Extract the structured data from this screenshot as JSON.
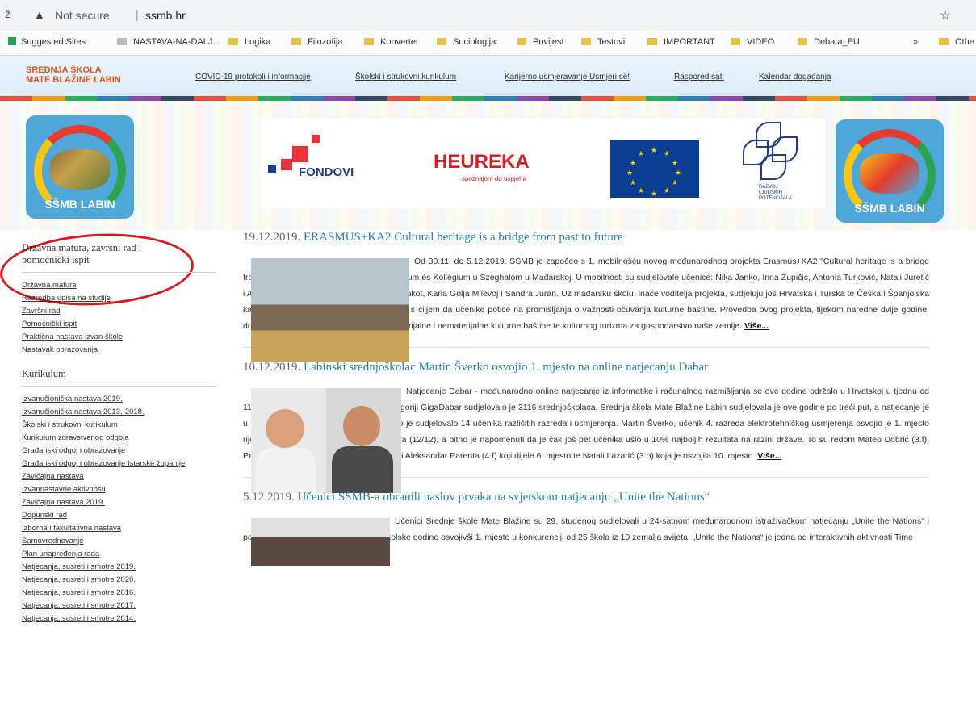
{
  "browser": {
    "back": "ž",
    "warning_icon": "warning-triangle-icon",
    "not_secure": "Not secure",
    "separator": "|",
    "url": "ssmb.hr",
    "star": "☆"
  },
  "bookmarks": [
    {
      "label": "Suggested Sites",
      "kind": "site"
    },
    {
      "label": "NASTAVA-NA-DALJ...",
      "kind": "page"
    },
    {
      "label": "Logika",
      "kind": "folder"
    },
    {
      "label": "Filozofija",
      "kind": "folder"
    },
    {
      "label": "Konverter",
      "kind": "folder"
    },
    {
      "label": "Sociologija",
      "kind": "folder"
    },
    {
      "label": "Povijest",
      "kind": "folder"
    },
    {
      "label": "Testovi",
      "kind": "folder"
    },
    {
      "label": "IMPORTANT",
      "kind": "folder"
    },
    {
      "label": "VIDEO",
      "kind": "folder"
    },
    {
      "label": "Debata_EU",
      "kind": "folder"
    },
    {
      "label": "»",
      "kind": "more"
    },
    {
      "label": "Othe",
      "kind": "folder"
    }
  ],
  "header": {
    "school_line1": "SREDNJA ŠKOLA",
    "school_line2": "MATE BLAŽINE LABIN",
    "nav": [
      "COVID-19 protokoli i informacije",
      "Školski i strukovni kurikulum",
      "Karijerno usmjeravanje Usmjeri se!",
      "Raspored sati",
      "Kalendar događanja"
    ]
  },
  "logos": {
    "left_text": "SŠMB LABIN",
    "right_text": "SŠMB LABIN",
    "fondovi": "FONDOVI",
    "heureka": "HEUREKA",
    "heureka_sub": "spoznajom do uspjeha",
    "esf_text": "RAZVOJ LJUDSKIH POTENCIJALA"
  },
  "sidebar": {
    "section1_title": "Državna matura, završni rad i pomoćnički ispit",
    "section1_links": [
      "Državna matura",
      "Razredba upisa na studije",
      "Završni rad",
      "Pomoćnički ispit",
      "Praktična nastava izvan škole",
      "Nastavak obrazovanja"
    ],
    "section2_title": "Kurikulum",
    "section2_links": [
      "Izvanučionička nastava 2019.",
      "Izvanučionička nastava 2013.-2018.",
      "Školski i strukovni kurikulum",
      "Kurikulum zdravstvenog odgoja",
      "Građanski odgoj i obrazovanje",
      "Građanski odgoj i obrazovanje Istarske županije",
      "Zavičajna nastava",
      "Izvannastavne aktivnosti",
      "Zavičajna nastava 2019.",
      "Dopunski rad",
      "Izborna i fakultativna nastava",
      "Samovrednovanje",
      "Plan unapređenja rada",
      "Natjecanja, susreti i smotre 2019.",
      "Natjecanja, susreti i smotre 2020.",
      "Natjecanja, susreti i smotre 2016.",
      "Natjecanja, susreti i smotre 2017.",
      "Natjecanja, susreti i smotre 2014."
    ]
  },
  "articles": [
    {
      "date": "19.12.2019.",
      "title": "ERASMUS+KA2 Cultural heritage is a bridge from past to future",
      "body": "Od 30.11. do 5.12.2019. SŠMB je započeo s 1. mobilnošću novog međunarodnog projekta Erasmus+KA2 \"Cultural heritage is a bridge from past to future\" u Péter András Gimnázium és Kollégium u Szeghalom u Mađarskoj. U mobilnosti su sudjelovale učenice: Nika Janko, Irina Zupičić, Antonia Turković, Natali Juretić i Ana Elena Zustović te profesorice Laura Kokot, Karla Golja Milevoj i Sandra Juran. Uz mađarsku školu, inače voditelja projekta, sudjeluju još Hrvatska i Turska te Češka i Španjolska kao partnerske zemlje. Projekt je osmišljen s ciljem da učenike potiče na promišljanja o važnosti očuvanja kulturne baštine. Provedba ovog projekta, tijekom naredne dvije godine, doprinijet će važnosti zaštite održivosti materijalne i nematerijalne kulturne baštine te kulturnog turizma za gospodarstvo naše zemlje.",
      "more": "Više..."
    },
    {
      "date": "10.12.2019.",
      "title": "Labinski srednjoškolac Martin Šverko osvojio 1. mjesto na online natjecanju Dabar",
      "body": "Natjecanje Dabar - međunarodno online natjecanje iz informatike i računalnog razmišljanja se ove godine održalo u Hrvatskoj u tjednu od 11.11. do 15.11. Na razini Hrvatske u kategoriji GigaDabar sudjelovalo je 3116 srednjoškolaca. Srednja škola Mate Blažine Labin sudjelovala je ove godine po treći put, a natjecanje je u našoj školi provedeno 11.11. Sveukupno je sudjelovalo 14 učenika različitih razreda i usmjerenja. Martin Šverko, učenik 4. razreda elektrotehničkog usmjerenja osvojio je 1. mjesto riješivši test s maksimalnim brojem bodova (12/12), a bitno je napomenuti da je čak još pet učenika ušlo u 10% najboljih rezultata na razini države. To su redom Mateo Dobrić (3.f), Petar Dundara (3.e), Ema Načinović (4.e) i Aleksandar Parenta (4.f) koji dijele 6. mjesto te Natali Lazarić (3.o) koja je osvojila 10. mjesto.",
      "more": "Više..."
    },
    {
      "date": "5.12.2019.",
      "title": "Učenici SŠMB-a obranili naslov prvaka na svjetskom natjecanju „Unite the Nations“",
      "body": "Učenici Srednje škole Mate Blažine su 29. studenog sudjelovali u 24-satnom međunarodnom istraživačkom natjecanju „Unite the Nations“ i ponovili izvanredan uspjeh od prošle školske godine osvojivši 1. mjesto u konkurenciji od 25 škola iz 10 zemalja svijeta. „Unite the Nations“ je jedna od interaktivnih aktivnosti Time",
      "more": ""
    }
  ]
}
